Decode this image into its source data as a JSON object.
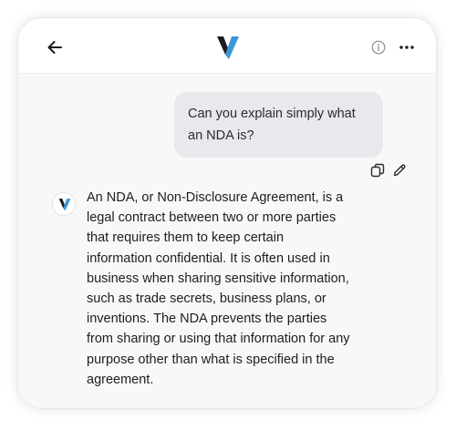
{
  "header": {
    "back_icon": "arrow-left-icon",
    "logo_icon": "brand-v-logo-icon",
    "info_icon": "info-circle-icon",
    "more_icon": "more-horizontal-icon"
  },
  "colors": {
    "logo_dark": "#1c1c24",
    "logo_blue": "#3a98d6",
    "user_bubble_bg": "#e8e9ec",
    "chat_bg": "#f8f8f9"
  },
  "conversation": {
    "user_message": "Can you explain simply what an NDA is?",
    "message_actions": {
      "copy_icon": "copy-icon",
      "edit_icon": "pencil-icon"
    },
    "assistant_avatar_icon": "brand-v-logo-icon",
    "assistant_message": "An NDA, or Non-Disclosure Agreement, is a legal contract between two or more parties that requires them to keep certain information confidential. It is often used in business when sharing sensitive information, such as trade secrets, business plans, or inventions. The NDA prevents the parties from sharing or using that information for any purpose other than what is specified in the agreement."
  }
}
